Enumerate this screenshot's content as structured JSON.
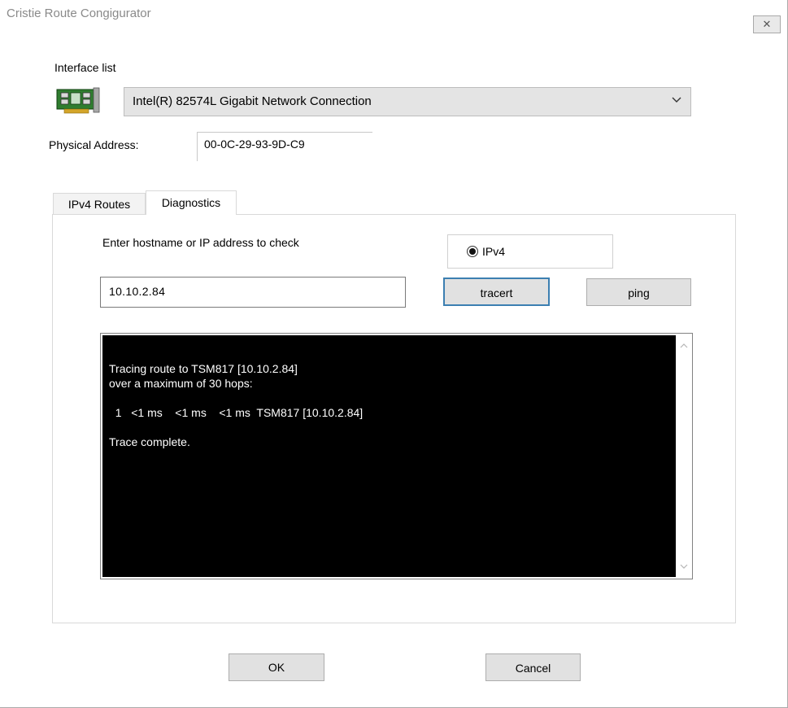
{
  "window": {
    "title": "Cristie Route Congigurator",
    "close_glyph": "✕"
  },
  "interface": {
    "label": "Interface list",
    "icon": "network-card-icon",
    "selected": "Intel(R) 82574L Gigabit Network Connection"
  },
  "physical": {
    "label": "Physical Address:",
    "value": "00-0C-29-93-9D-C9"
  },
  "tabs": [
    {
      "label": "IPv4 Routes",
      "active": false
    },
    {
      "label": "Diagnostics",
      "active": true
    }
  ],
  "diagnostics": {
    "prompt": "Enter hostname or IP address to check",
    "ip_version_label": "IPv4",
    "ip_version_selected": true,
    "host_value": "10.10.2.84",
    "tracert_label": "tracert",
    "ping_label": "ping",
    "output_lines": [
      "Tracing route to TSM817 [10.10.2.84]",
      "over a maximum of 30 hops:",
      "",
      "  1   <1 ms    <1 ms    <1 ms  TSM817 [10.10.2.84]",
      "",
      "Trace complete."
    ]
  },
  "footer": {
    "ok_label": "OK",
    "cancel_label": "Cancel"
  },
  "colors": {
    "focus_border": "#3c7fb1",
    "console_bg": "#000000",
    "console_fg": "#ffffff"
  }
}
